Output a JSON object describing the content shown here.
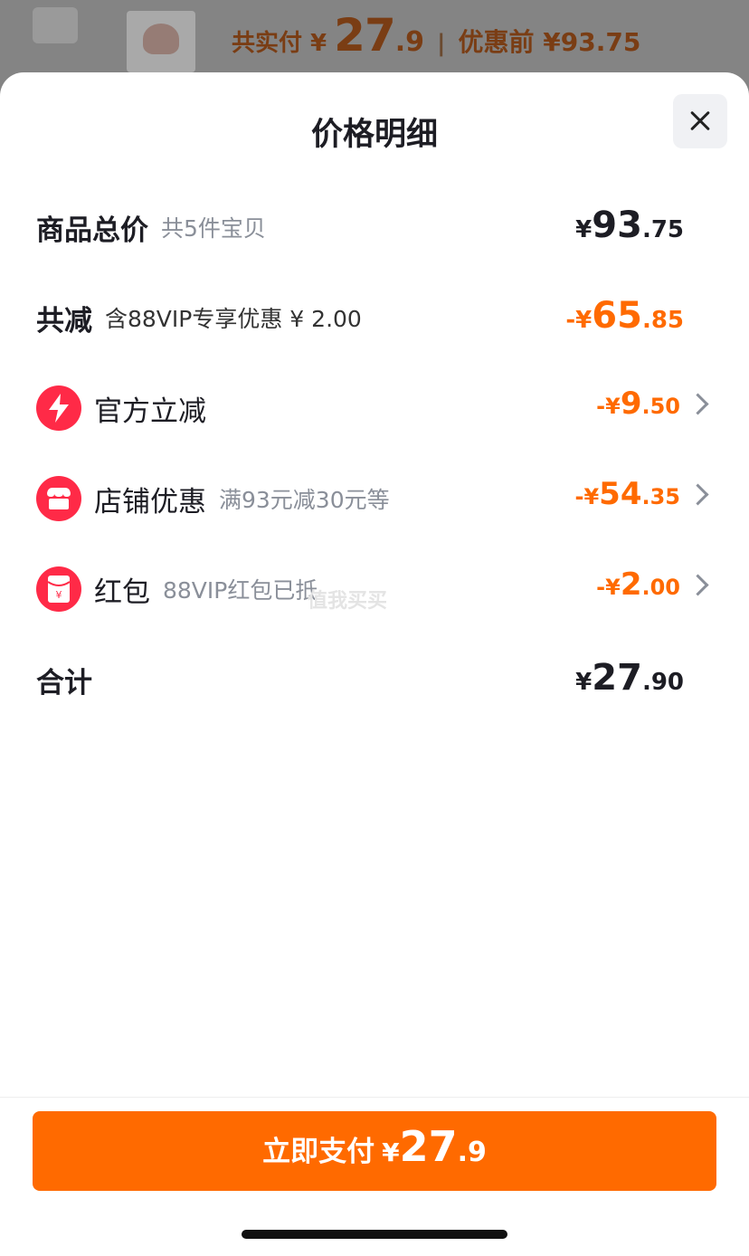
{
  "background": {
    "summary_label": "共实付 ¥",
    "summary_int": "27",
    "summary_frac": ".9",
    "summary_sep": "|",
    "summary_prev": "优惠前 ¥93.75"
  },
  "sheet": {
    "title": "价格明细",
    "rows": [
      {
        "label": "商品总价",
        "sub": "共5件宝贝",
        "currency": "¥",
        "int": "93",
        "frac": ".75"
      },
      {
        "label": "共减",
        "sub": "含88VIP专享优惠 ¥ 2.00",
        "currency": "-¥",
        "int": "65",
        "frac": ".85"
      },
      {
        "label": "官方立减",
        "sub": "",
        "currency": "-¥",
        "int": "9",
        "frac": ".50",
        "icon": "lightning-icon"
      },
      {
        "label": "店铺优惠",
        "sub": "满93元减30元等",
        "currency": "-¥",
        "int": "54",
        "frac": ".35",
        "icon": "shop-icon"
      },
      {
        "label": "红包",
        "sub": "88VIP红包已抵",
        "currency": "-¥",
        "int": "2",
        "frac": ".00",
        "icon": "red-packet-icon"
      },
      {
        "label": "合计",
        "sub": "",
        "currency": "¥",
        "int": "27",
        "frac": ".90"
      }
    ],
    "watermark": "值我买买"
  },
  "pay_button": {
    "label": "立即支付",
    "currency": "¥",
    "int": "27",
    "frac": ".9"
  },
  "colors": {
    "accent": "#ff6a00",
    "icon_red": "#ff2a47",
    "text_dark": "#1d1d24",
    "text_gray": "#8a8f99"
  }
}
